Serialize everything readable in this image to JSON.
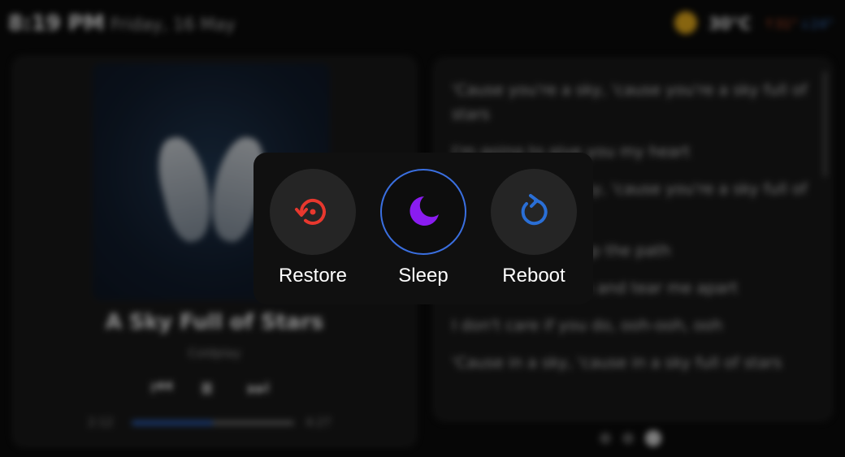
{
  "status_bar": {
    "time": "8:19 PM",
    "date": "Friday, 16 May",
    "weather_icon": "sun-icon",
    "temperature": "30°C",
    "temp_high": "↑31°",
    "temp_low": "↓24°"
  },
  "player": {
    "album_art_icon": "album-art",
    "title": "A Sky Full of Stars",
    "artist": "Coldplay",
    "elapsed": "2:12",
    "total": "4:27",
    "progress": 0.5,
    "prev_icon": "⏮",
    "pause_icon": "⏸",
    "next_icon": "⏭"
  },
  "lyrics": {
    "lines": [
      "'Cause you're a sky, 'cause you're a sky full of stars",
      "I'm going to give you my heart",
      "'Cause you're a sky, 'cause you're a sky full of stars",
      "'Cause you light up the path",
      "I don't care, go on and tear me apart",
      "I don't care if you do, ooh-ooh, ooh",
      "'Cause in a sky, 'cause in a sky full of stars"
    ]
  },
  "pagination": {
    "count": 3,
    "active": 3
  },
  "power_menu": {
    "restore": {
      "label": "Restore",
      "icon": "restore-icon",
      "color": "#e8382e"
    },
    "sleep": {
      "label": "Sleep",
      "icon": "moon-icon",
      "color": "#8a1cf0",
      "ring_color": "#3a6fe0"
    },
    "reboot": {
      "label": "Reboot",
      "icon": "reboot-icon",
      "color": "#2a6fd6"
    }
  }
}
